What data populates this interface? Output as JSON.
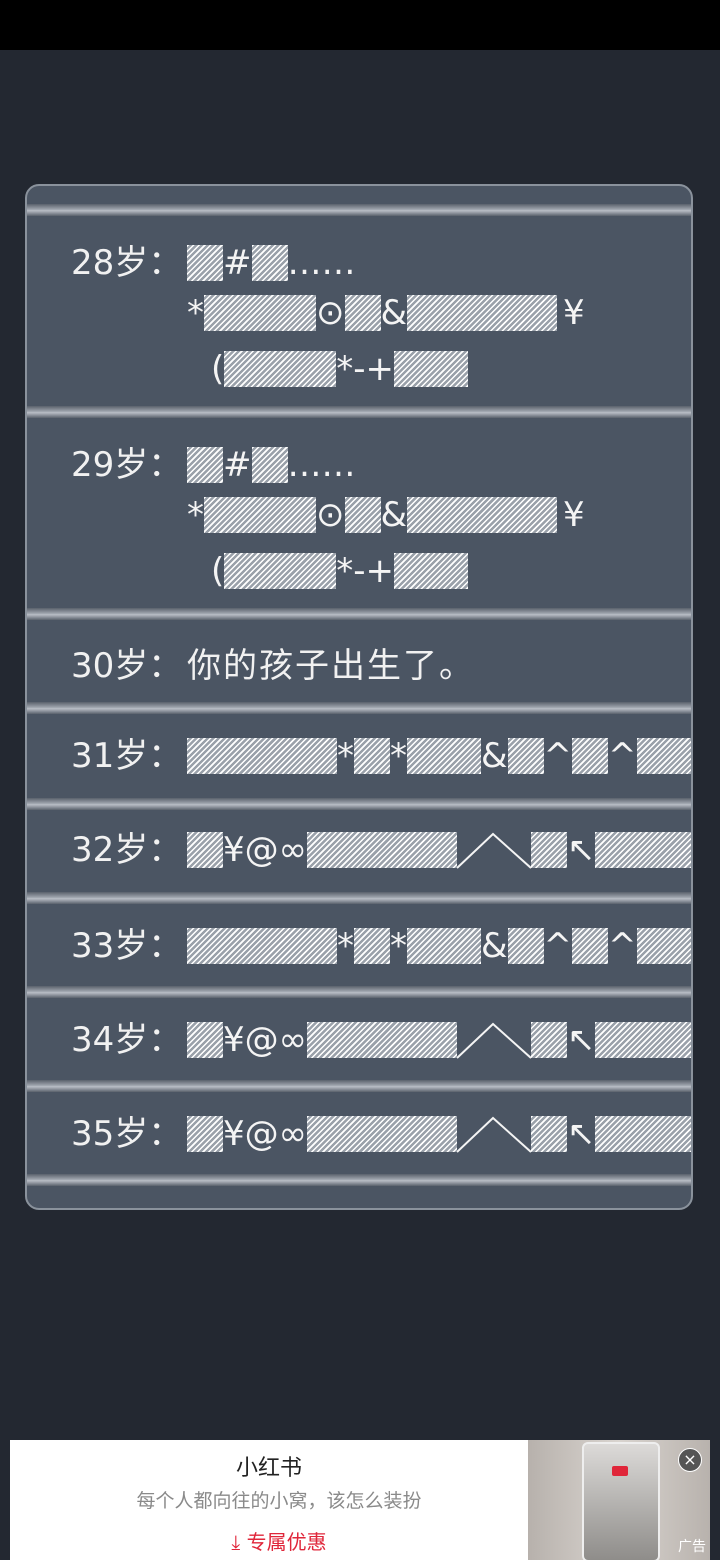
{
  "timeline": [
    {
      "age_label": "28岁："
    },
    {
      "age_label": "29岁："
    },
    {
      "age_label": "30岁：",
      "text": "你的孩子出生了。"
    },
    {
      "age_label": "31岁："
    },
    {
      "age_label": "32岁："
    },
    {
      "age_label": "33岁："
    },
    {
      "age_label": "34岁："
    },
    {
      "age_label": "35岁："
    }
  ],
  "ad": {
    "title": "小红书",
    "subtitle": "每个人都向往的小窝，该怎么装扮",
    "cta": "专属优惠",
    "cta_icon": "download-arrow-icon",
    "ad_tag": "广告",
    "close_icon": "close-icon"
  }
}
